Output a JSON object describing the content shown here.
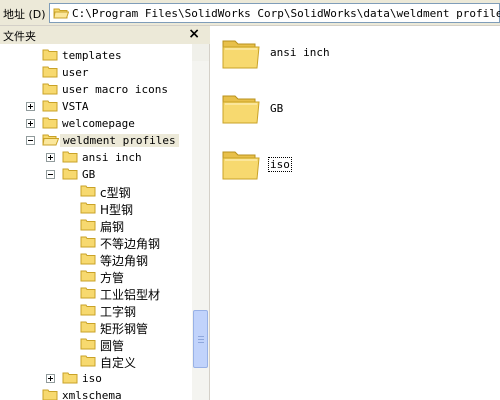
{
  "address_bar": {
    "label": "地址 (D)",
    "path": "C:\\Program Files\\SolidWorks Corp\\SolidWorks\\data\\weldment profiles"
  },
  "folders_pane": {
    "title": "文件夹",
    "close_glyph": "×",
    "items": [
      {
        "label": "templates"
      },
      {
        "label": "user"
      },
      {
        "label": "user macro icons"
      },
      {
        "label": "VSTA"
      },
      {
        "label": "welcomepage"
      },
      {
        "label": "weldment profiles"
      },
      {
        "label": "ansi inch"
      },
      {
        "label": "GB"
      },
      {
        "label": "c型钢"
      },
      {
        "label": "H型钢"
      },
      {
        "label": "扁钢"
      },
      {
        "label": "不等边角钢"
      },
      {
        "label": "等边角钢"
      },
      {
        "label": "方管"
      },
      {
        "label": "工业铝型材"
      },
      {
        "label": "工字钢"
      },
      {
        "label": "矩形钢管"
      },
      {
        "label": "圆管"
      },
      {
        "label": "自定义"
      },
      {
        "label": "iso"
      },
      {
        "label": "xmlschema"
      }
    ]
  },
  "content": {
    "folders": [
      {
        "label": "ansi inch"
      },
      {
        "label": "GB"
      },
      {
        "label": "iso"
      }
    ]
  },
  "colors": {
    "folder_fill": "#f7d96f",
    "folder_edge": "#c9a227",
    "chrome": "#ece9d8",
    "scroll_thumb": "#c1d3fb"
  },
  "icons": {
    "folder": "folder-icon",
    "open_folder": "folder-open-icon",
    "expand": "plus-expander-icon",
    "collapse": "minus-expander-icon"
  }
}
